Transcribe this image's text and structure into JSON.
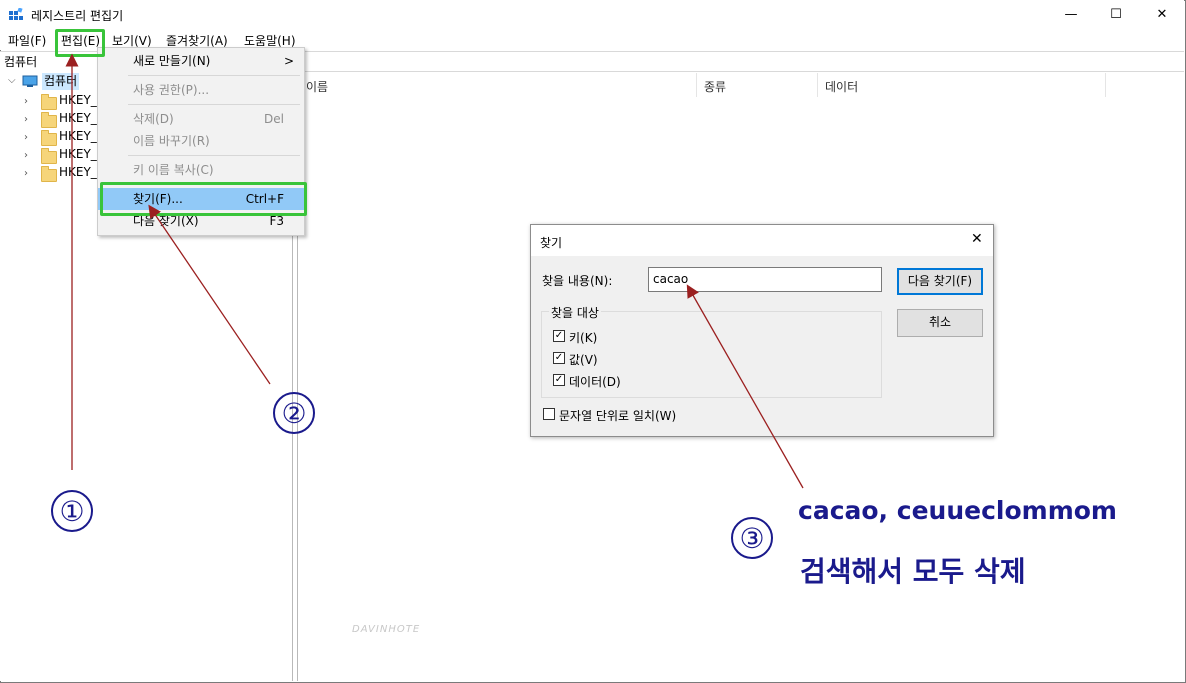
{
  "window": {
    "title": "레지스트리 편집기",
    "minimize": "—",
    "maximize": "☐",
    "close": "✕"
  },
  "menubar": {
    "items": [
      "파일(F)",
      "편집(E)",
      "보기(V)",
      "즐겨찾기(A)",
      "도움말(H)"
    ]
  },
  "address": "컴퓨터",
  "tree": {
    "root": "컴퓨터",
    "children": [
      "HKEY_C",
      "HKEY_C",
      "HKEY_L",
      "HKEY_U",
      "HKEY_C"
    ]
  },
  "columns": [
    "이름",
    "종류",
    "데이터"
  ],
  "edit_menu": {
    "items": [
      {
        "label": "새로 만들기(N)",
        "shortcut": "",
        "submenu": ">",
        "disabled": false
      },
      {
        "label": "사용 권한(P)...",
        "shortcut": "",
        "disabled": true
      },
      {
        "label": "삭제(D)",
        "shortcut": "Del",
        "disabled": true
      },
      {
        "label": "이름 바꾸기(R)",
        "shortcut": "",
        "disabled": true
      },
      {
        "label": "키 이름 복사(C)",
        "shortcut": "",
        "disabled": true
      },
      {
        "label": "찾기(F)...",
        "shortcut": "Ctrl+F",
        "disabled": false,
        "selected": true
      },
      {
        "label": "다음 찾기(X)",
        "shortcut": "F3",
        "disabled": false
      }
    ]
  },
  "find_dialog": {
    "title": "찾기",
    "find_label": "찾을 내용(N):",
    "find_value": "cacao",
    "find_next_button": "다음 찾기(F)",
    "cancel_button": "취소",
    "look_at_group": "찾을 대상",
    "options": [
      {
        "label": "키(K)",
        "checked": true
      },
      {
        "label": "값(V)",
        "checked": true
      },
      {
        "label": "데이터(D)",
        "checked": true
      }
    ],
    "match_whole": {
      "label": "문자열 단위로 일치(W)",
      "checked": false
    }
  },
  "annotations": {
    "step1": "①",
    "step2": "②",
    "step3": "③",
    "note_line1": "cacao, ceuueclommom",
    "note_line2": "검색해서 모두 삭제",
    "color": "#1a1a8c",
    "highlight_color": "#39c43a",
    "arrow_color": "#9b2020"
  },
  "watermark": "DAVINHOTE"
}
